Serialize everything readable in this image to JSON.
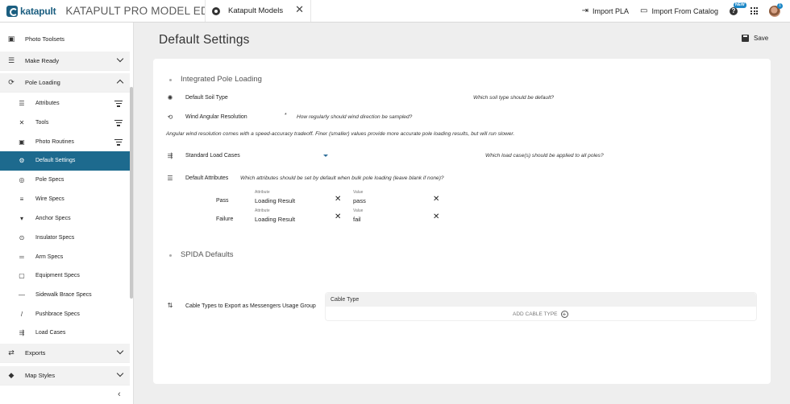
{
  "header": {
    "logo_text": "katapult",
    "app_title": "KATAPULT PRO MODEL EDITOR",
    "tab_label": "Katapult Models",
    "close_glyph": "✕",
    "import_pla": "Import PLA",
    "import_catalog": "Import From Catalog",
    "help_glyph": "?",
    "new_badge": "NEW",
    "avatar_badge": "1"
  },
  "sidebar": {
    "groups": {
      "photo_toolsets": "Photo Toolsets",
      "make_ready": "Make Ready",
      "pole_loading": "Pole Loading",
      "exports": "Exports",
      "map_styles": "Map Styles"
    },
    "items": [
      {
        "label": "Attributes",
        "icon": "list-icon"
      },
      {
        "label": "Tools",
        "icon": "tools-icon"
      },
      {
        "label": "Photo Routines",
        "icon": "photo-icon"
      },
      {
        "label": "Default Settings",
        "icon": "gear-icon"
      },
      {
        "label": "Pole Specs",
        "icon": "pole-icon"
      },
      {
        "label": "Wire Specs",
        "icon": "wire-icon"
      },
      {
        "label": "Anchor Specs",
        "icon": "anchor-icon"
      },
      {
        "label": "Insulator Specs",
        "icon": "insulator-icon"
      },
      {
        "label": "Arm Specs",
        "icon": "arm-icon"
      },
      {
        "label": "Equipment Specs",
        "icon": "equipment-icon"
      },
      {
        "label": "Sidewalk Brace Specs",
        "icon": "sidewalk-brace-icon"
      },
      {
        "label": "Pushbrace Specs",
        "icon": "pushbrace-icon"
      },
      {
        "label": "Load Cases",
        "icon": "load-cases-icon"
      }
    ],
    "collapse_glyph": "‹"
  },
  "main": {
    "title": "Default Settings",
    "save_label": "Save",
    "integrated": {
      "title": "Integrated Pole Loading",
      "soil_label": "Default Soil Type",
      "soil_hint": "Which soil type should be default?",
      "wind_label": "Wind Angular Resolution",
      "wind_required": "*",
      "wind_hint": "How regularly should wind direction be sampled?",
      "wind_note": "Angular wind resolution comes with a speed-accuracy tradeoff. Finer (smaller) values provide more accurate pole loading results, but will run slower.",
      "load_cases_label": "Standard Load Cases",
      "load_cases_hint": "Which load case(s) should be applied to all poles?",
      "attrs_label": "Default Attributes",
      "attrs_hint": "Which attributes should be set by default when bulk pole loading (leave blank if none)?",
      "rows": [
        {
          "name": "Pass",
          "attribute_caption": "Attribute",
          "attribute": "Loading Result",
          "value_caption": "Value",
          "value": "pass"
        },
        {
          "name": "Failure",
          "attribute_caption": "Attribute",
          "attribute": "Loading Result",
          "value_caption": "Value",
          "value": "fail"
        }
      ]
    },
    "spida": {
      "title": "SPIDA Defaults",
      "cable_label": "Cable Types to Export as Messengers Usage Group",
      "cable_header": "Cable Type",
      "add_cable": "ADD CABLE TYPE"
    }
  }
}
